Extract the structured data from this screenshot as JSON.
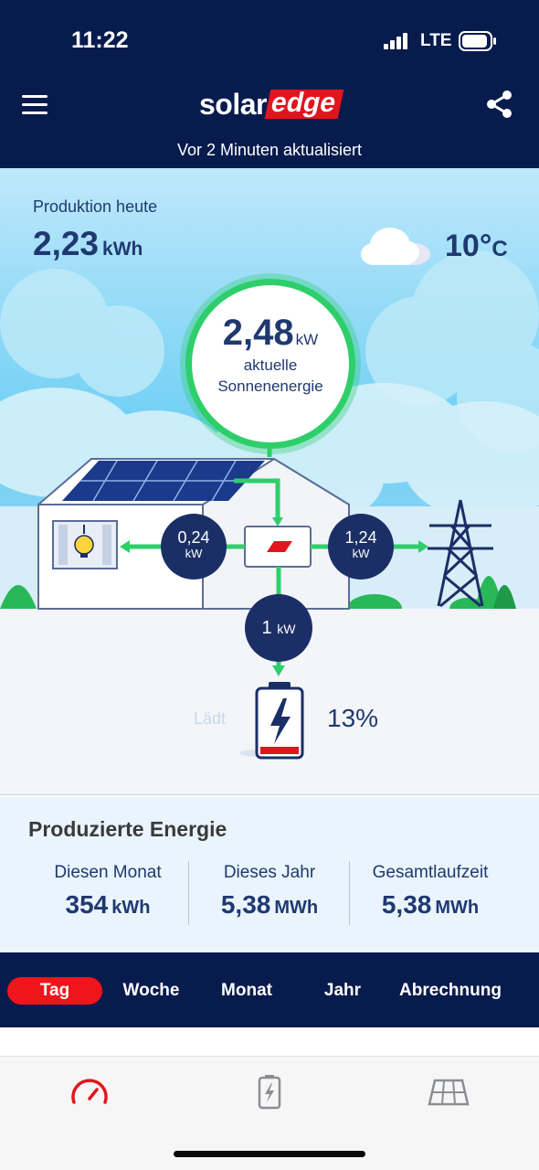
{
  "status_bar": {
    "time": "11:22",
    "network": "LTE"
  },
  "header": {
    "logo": {
      "part1": "solar",
      "part2": "edge"
    },
    "updated": "Vor 2 Minuten aktualisiert"
  },
  "production_today": {
    "label": "Produktion heute",
    "value": "2,23",
    "unit": "kWh"
  },
  "weather": {
    "icon": "cloud-icon",
    "temperature": "10°",
    "unit": "C"
  },
  "solar_power": {
    "value": "2,48",
    "unit": "kW",
    "line1": "aktuelle",
    "line2": "Sonnenenergie"
  },
  "flows": {
    "consumption": {
      "value": "0,24",
      "unit": "kW"
    },
    "grid": {
      "value": "1,24",
      "unit": "kW"
    },
    "battery": {
      "value": "1",
      "unit": "kW"
    }
  },
  "battery": {
    "status": "Lädt",
    "percent": "13%",
    "level": 0.13
  },
  "produced_energy": {
    "title": "Produzierte Energie",
    "columns": [
      {
        "label": "Diesen Monat",
        "value": "354",
        "unit": "kWh"
      },
      {
        "label": "Dieses Jahr",
        "value": "5,38",
        "unit": "MWh"
      },
      {
        "label": "Gesamtlaufzeit",
        "value": "5,38",
        "unit": "MWh"
      }
    ]
  },
  "period_tabs": [
    "Tag",
    "Woche",
    "Monat",
    "Jahr",
    "Abrechnung"
  ],
  "active_tab": "Tag",
  "bottom_nav": [
    "dashboard-icon",
    "battery-icon",
    "solar-panel-icon"
  ],
  "colors": {
    "navy": "#071b4d",
    "accent_red": "#f0141b",
    "green": "#2ecf6a",
    "node_blue": "#1b2e66"
  }
}
